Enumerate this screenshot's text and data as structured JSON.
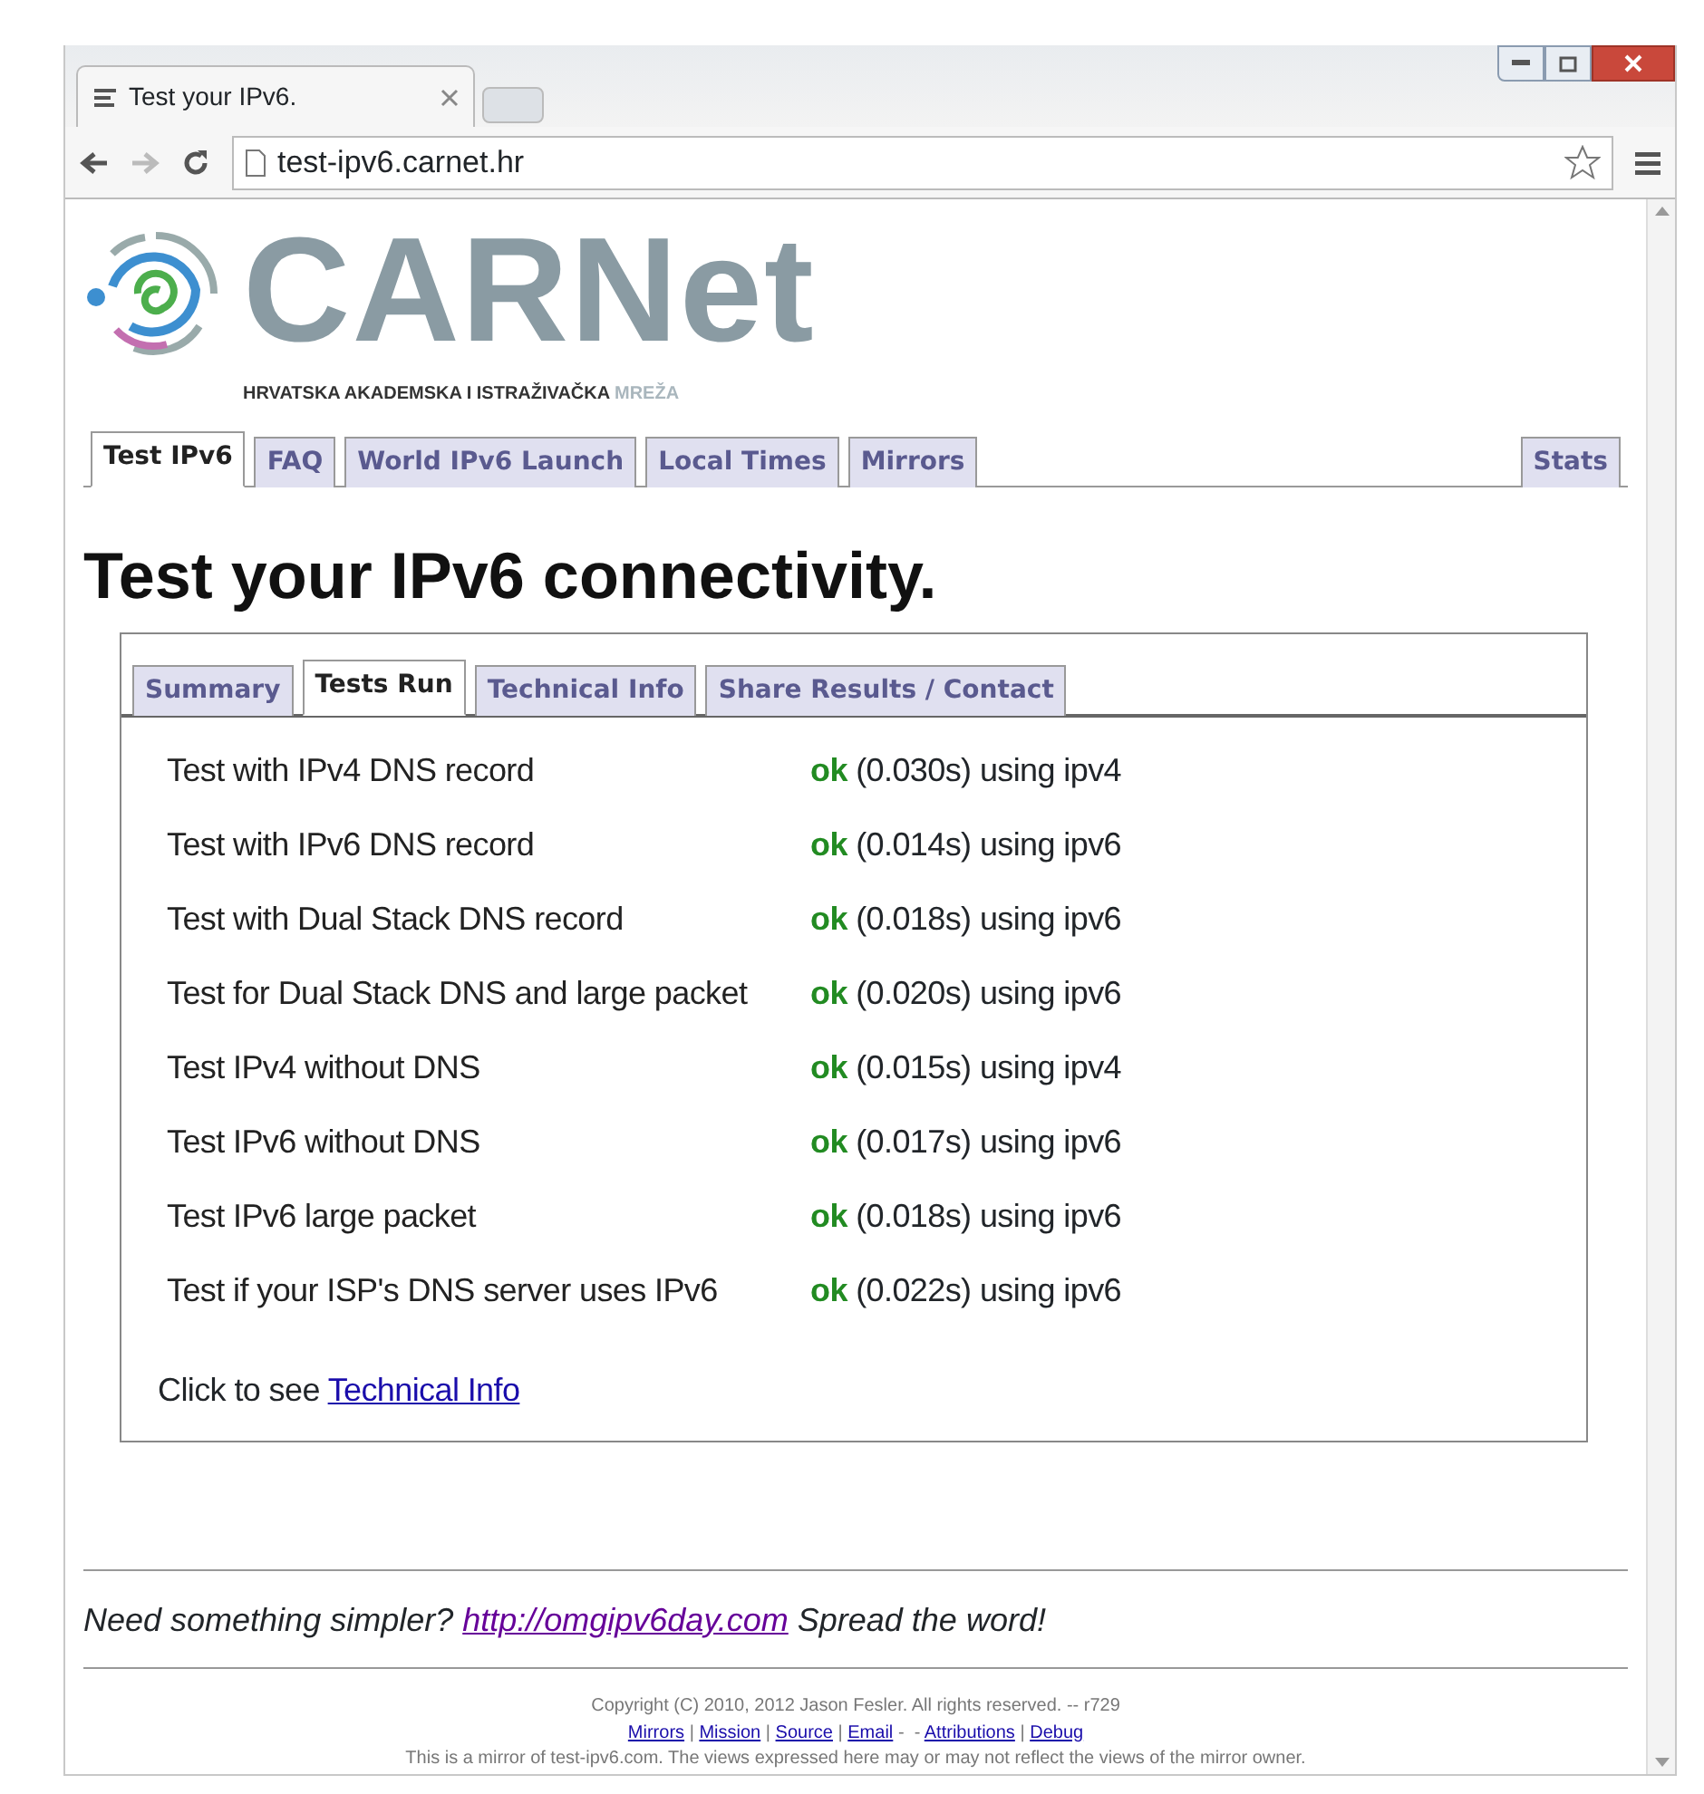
{
  "browser": {
    "tab_title": "Test your IPv6.",
    "url": "test-ipv6.carnet.hr"
  },
  "logo": {
    "wordmark": "CARNet",
    "tagline": "HRVATSKA AKADEMSKA I ISTRAŽIVAČKA",
    "tagline_accent": "MREŽA"
  },
  "tabs": [
    {
      "label": "Test IPv6",
      "selected": true
    },
    {
      "label": "FAQ",
      "selected": false
    },
    {
      "label": "World IPv6 Launch",
      "selected": false
    },
    {
      "label": "Local Times",
      "selected": false
    },
    {
      "label": "Mirrors",
      "selected": false
    }
  ],
  "right_tabs": [
    {
      "label": "Stats",
      "selected": false
    }
  ],
  "heading": "Test your IPv6 connectivity.",
  "inner_tabs": [
    {
      "label": "Summary",
      "selected": false
    },
    {
      "label": "Tests Run",
      "selected": true
    },
    {
      "label": "Technical Info",
      "selected": false
    },
    {
      "label": "Share Results / Contact",
      "selected": false
    }
  ],
  "tests": [
    {
      "name": "Test with IPv4 DNS record",
      "status": "ok",
      "detail": "(0.030s) using ipv4"
    },
    {
      "name": "Test with IPv6 DNS record",
      "status": "ok",
      "detail": "(0.014s) using ipv6"
    },
    {
      "name": "Test with Dual Stack DNS record",
      "status": "ok",
      "detail": "(0.018s) using ipv6"
    },
    {
      "name": "Test for Dual Stack DNS and large packet",
      "status": "ok",
      "detail": "(0.020s) using ipv6"
    },
    {
      "name": "Test IPv4 without DNS",
      "status": "ok",
      "detail": "(0.015s) using ipv4"
    },
    {
      "name": "Test IPv6 without DNS",
      "status": "ok",
      "detail": "(0.017s) using ipv6"
    },
    {
      "name": "Test IPv6 large packet",
      "status": "ok",
      "detail": "(0.018s) using ipv6"
    },
    {
      "name": "Test if your ISP's DNS server uses IPv6",
      "status": "ok",
      "detail": "(0.022s) using ipv6"
    }
  ],
  "see_more": {
    "prefix": "Click to see",
    "link": "Technical Info"
  },
  "promo": {
    "prefix": "Need something simpler?",
    "link": "http://omgipv6day.com",
    "suffix": "Spread the word!"
  },
  "footer": {
    "copyright": "Copyright (C) 2010, 2012 Jason Fesler. All rights reserved. -- r729",
    "links": [
      {
        "kind": "link",
        "text": "Mirrors"
      },
      {
        "kind": "text",
        "text": "|"
      },
      {
        "kind": "link",
        "text": "Mission"
      },
      {
        "kind": "text",
        "text": "|"
      },
      {
        "kind": "link",
        "text": "Source"
      },
      {
        "kind": "text",
        "text": "|"
      },
      {
        "kind": "link",
        "text": "Email"
      },
      {
        "kind": "text",
        "text": "-  -"
      },
      {
        "kind": "link",
        "text": "Attributions"
      },
      {
        "kind": "text",
        "text": "|"
      },
      {
        "kind": "link",
        "text": "Debug"
      }
    ],
    "mirror_note": "This is a mirror of test-ipv6.com. The views expressed here may or may not reflect the views of the mirror owner."
  }
}
